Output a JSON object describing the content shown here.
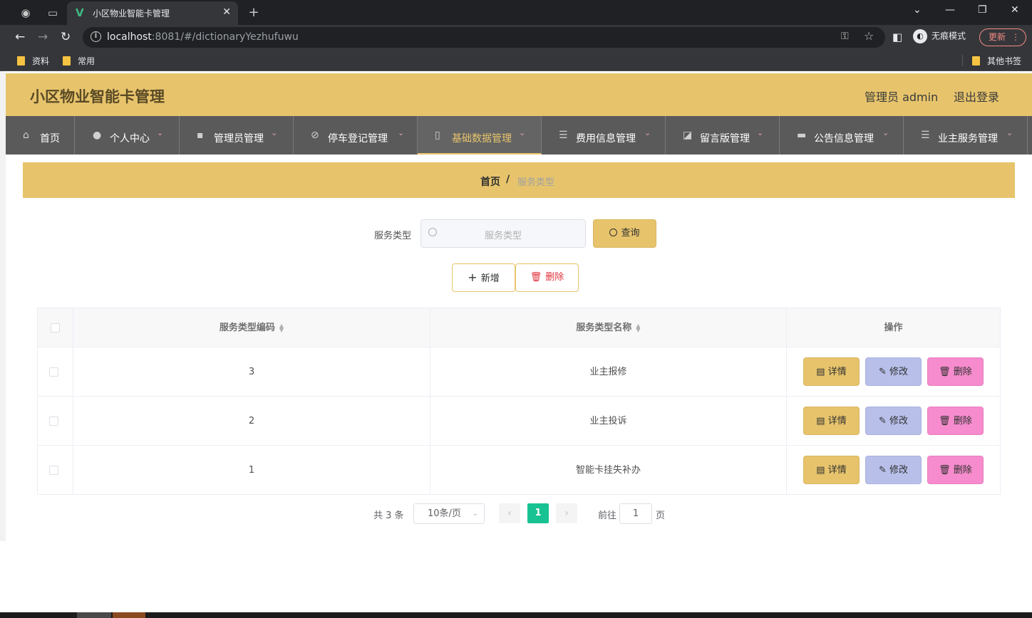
{
  "browser": {
    "tab_title": "小区物业智能卡管理",
    "url_host": "localhost",
    "url_rest": ":8081/#/dictionaryYezhufuwu",
    "incognito_label": "无痕模式",
    "update_label": "更新",
    "bookmarks": [
      "资料",
      "常用"
    ],
    "other_bookmarks": "其他书签"
  },
  "header": {
    "title": "小区物业智能卡管理",
    "admin_label": "管理员 admin",
    "logout_label": "退出登录"
  },
  "menu": [
    {
      "label": "首页",
      "icon": "home-icon"
    },
    {
      "label": "个人中心",
      "icon": "user-icon"
    },
    {
      "label": "管理员管理",
      "icon": "chat-icon"
    },
    {
      "label": "停车登记管理",
      "icon": "bell-off-icon"
    },
    {
      "label": "基础数据管理",
      "icon": "microphone-icon",
      "active": true
    },
    {
      "label": "费用信息管理",
      "icon": "sliders-icon"
    },
    {
      "label": "留言版管理",
      "icon": "chart-icon"
    },
    {
      "label": "公告信息管理",
      "icon": "reading-icon"
    },
    {
      "label": "业主服务管理",
      "icon": "list-icon"
    }
  ],
  "breadcrumb": {
    "home": "首页",
    "separator": "/",
    "current": "服务类型"
  },
  "search": {
    "label": "服务类型",
    "placeholder": "服务类型",
    "query_label": "查询"
  },
  "actions": {
    "add_label": "新增",
    "delete_label": "删除"
  },
  "table": {
    "columns": [
      "服务类型编码",
      "服务类型名称",
      "操作"
    ],
    "rows": [
      {
        "code": "3",
        "name": "业主报修"
      },
      {
        "code": "2",
        "name": "业主投诉"
      },
      {
        "code": "1",
        "name": "智能卡挂失补办"
      }
    ],
    "row_actions": {
      "detail": "详情",
      "edit": "修改",
      "remove": "删除"
    }
  },
  "pagination": {
    "total_text": "共 3 条",
    "page_size": "10条/页",
    "current_page": "1",
    "goto_label": "前往",
    "goto_value": "1",
    "goto_suffix": "页"
  },
  "colors": {
    "accent": "#e7c46c",
    "menu_bg": "#5a5a5a",
    "page_active": "#19c293",
    "edit": "#b8c0ea",
    "remove": "#f68ccd"
  }
}
